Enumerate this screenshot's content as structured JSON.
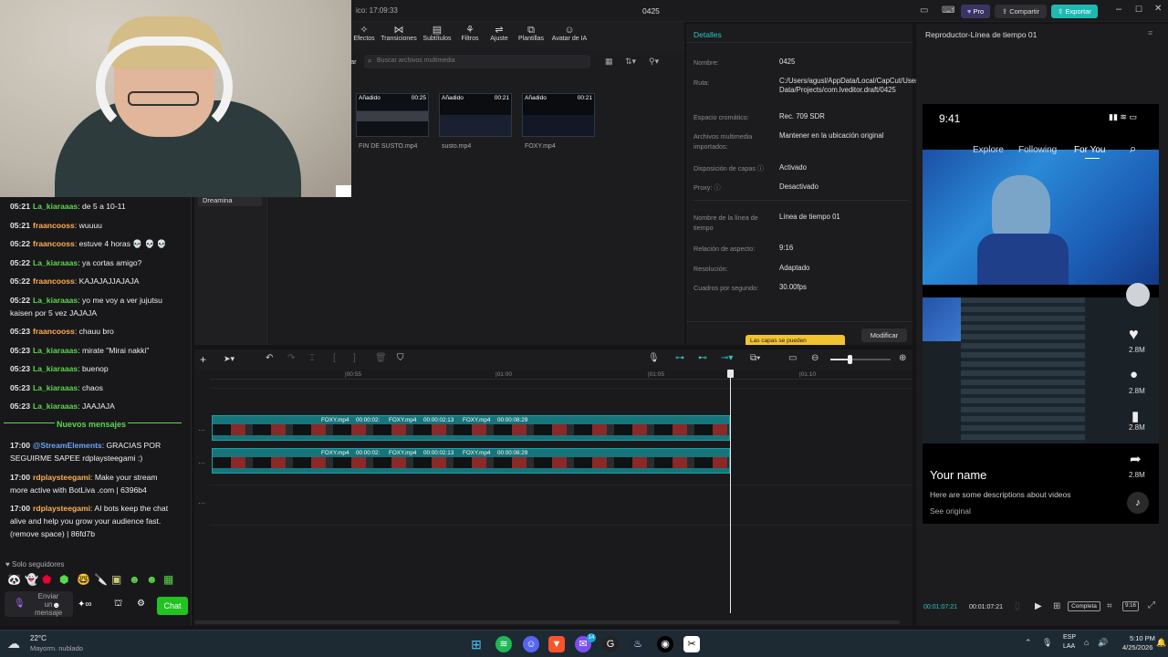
{
  "window": {
    "title": "0425",
    "autosave": "ico: 17:09:33",
    "pro_label": "Pro",
    "share_label": "Compartir",
    "export_label": "Exportar"
  },
  "toolbar": {
    "tools": [
      "Efectos",
      "Transiciones",
      "Subtítulos",
      "Filtros",
      "Ajuste",
      "Plantillas",
      "Avatar de IA"
    ]
  },
  "media": {
    "search_placeholder": "Buscar archivos multimedia",
    "import_label": "ar",
    "sidebar_item": "Dreamina",
    "clips": [
      {
        "tag": "Añadido",
        "duration": "00:25",
        "name": "FIN DE SUSTO.mp4"
      },
      {
        "tag": "Añadido",
        "duration": "00:21",
        "name": "susto.mp4"
      },
      {
        "tag": "Añadido",
        "duration": "00:21",
        "name": "FOXY.mp4"
      }
    ]
  },
  "details": {
    "header": "Detalles",
    "rows": [
      {
        "label": "Nombre:",
        "value": "0425"
      },
      {
        "label": "Ruta:",
        "value": "C:/Users/agusl/AppData/Local/CapCut/User Data/Projects/com.lveditor.draft/0425"
      },
      {
        "label": "Espacio cromático:",
        "value": "Rec. 709 SDR"
      },
      {
        "label": "Archivos multimedia importados:",
        "value": "Mantener en la ubicación original"
      },
      {
        "label": "Disposición de capas ⓘ",
        "value": "Activado"
      },
      {
        "label": "Proxy: ⓘ",
        "value": "Desactivado"
      },
      {
        "label": "Nombre de la línea de tiempo",
        "value": "Línea de tiempo 01"
      },
      {
        "label": "Relación de aspecto:",
        "value": "9:16"
      },
      {
        "label": "Resolución:",
        "value": "Adaptado"
      },
      {
        "label": "Cuadros por segundo:",
        "value": "30.00fps"
      }
    ],
    "tooltip": "Las capas se pueden",
    "modify_label": "Modificar"
  },
  "player": {
    "header": "Reproductor-Línea de tiempo 01",
    "phone_time": "9:41",
    "tabs": [
      "Explore",
      "Following",
      "For You"
    ],
    "likes": [
      "2.8M",
      "2.8M",
      "2.8M",
      "2.8M"
    ],
    "username": "Your name",
    "description": "Here are some descriptions about videos",
    "see_original": "See original",
    "current_time": "00:01:07:21",
    "total_time": "00:01:07:21",
    "ratio_label": "Completa",
    "aspect_label": "9:16"
  },
  "timeline": {
    "ruler": [
      "|00:55",
      "|01:00",
      "|01:05",
      "|01:10"
    ],
    "segments": [
      "FOXY.mp4",
      "00:00:02:",
      "FOXY.mp4",
      "00:00:02:13",
      "FOXY.mp4",
      "00:00:08:29"
    ]
  },
  "chat": {
    "messages": [
      {
        "time": "05:21",
        "user": "La_kiaraaas",
        "color": "g",
        "text": ": de 5 a 10-11"
      },
      {
        "time": "05:21",
        "user": "fraancooss",
        "color": "o",
        "text": ": wuuuu"
      },
      {
        "time": "05:22",
        "user": "fraancooss",
        "color": "o",
        "text": ": estuve 4 horas 💀 💀 💀"
      },
      {
        "time": "05:22",
        "user": "La_kiaraaas",
        "color": "g",
        "text": ": ya cortas amigo?"
      },
      {
        "time": "05:22",
        "user": "fraancooss",
        "color": "o",
        "text": ": KAJAJAJJAJAJA"
      },
      {
        "time": "05:22",
        "user": "La_kiaraaas",
        "color": "g",
        "text": ": yo me voy a ver jujutsu kaisen por 5 vez JAJAJA"
      },
      {
        "time": "05:23",
        "user": "fraancooss",
        "color": "o",
        "text": ": chauu bro"
      },
      {
        "time": "05:23",
        "user": "La_kiaraaas",
        "color": "g",
        "text": ": mirate \"Mirai nakki\""
      },
      {
        "time": "05:23",
        "user": "La_kiaraaas",
        "color": "g",
        "text": ": buenop"
      },
      {
        "time": "05:23",
        "user": "La_kiaraaas",
        "color": "g",
        "text": ": chaos"
      },
      {
        "time": "05:23",
        "user": "La_kiaraaas",
        "color": "g",
        "text": ": JAAJAJA"
      }
    ],
    "new_messages": "Nuevos mensajes",
    "messages2": [
      {
        "time": "17:00",
        "user": "@StreamElements",
        "color": "b",
        "text": ": GRACIAS POR SEGUIRME SAPEE rdplaysteegami :)"
      },
      {
        "time": "17:00",
        "user": "rdplaysteegami",
        "color": "o",
        "text": ": Make your stream more active with BotLiva .com | 6396b4"
      },
      {
        "time": "17:00",
        "user": "rdplaysteegami",
        "color": "o",
        "text": ": AI bots keep the chat alive and help you grow your audience fast. (remove space) | 86fd7b"
      }
    ],
    "followers_only": "Solo seguidores",
    "input_placeholder": "Enviar un mensaje",
    "chat_button": "Chat"
  },
  "taskbar": {
    "weather_temp": "22°C",
    "weather_desc": "Mayorm. nublado",
    "lang_top": "ESP",
    "lang_bottom": "LAA",
    "time": "5:10 PM",
    "date": "4/25/2026",
    "badge": "14"
  }
}
